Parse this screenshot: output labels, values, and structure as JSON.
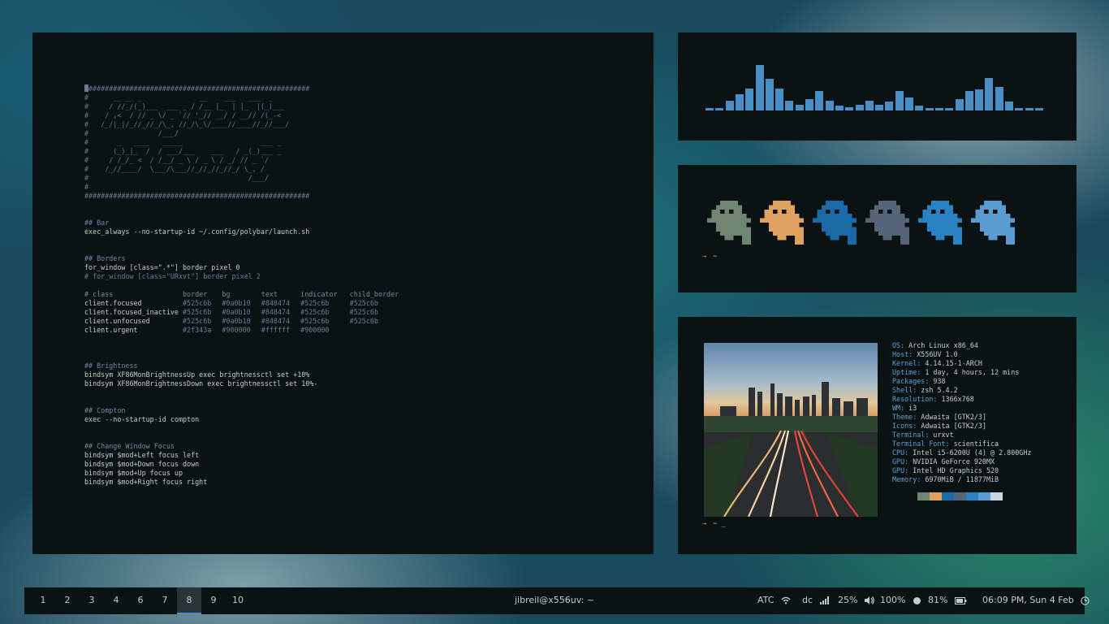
{
  "terminal": {
    "ascii_art": [
      "#######################################################",
      "#      __ __ _              __    ___   ___  _         ",
      "#     / //_/(_)___  ___ _ / /__ |_  | |_  |(_)___     ",
      "#    / ,<  / // _ \\/ _ `// '_// __/ / __// /(_-<     ",
      "#   /_/|_|/_//_//_/\\_, //_/\\_\\/____//____//_//___/     ",
      "#                 /___/                                ",
      "#       _   ____   _____                   ___ _       ",
      "#      (_)_|_  /  / ___/___    ___   / _(_)___ _      ",
      "#     / /_/_ <  / /__/ _ \\ / _ \\ / _/ // _ `/     ",
      "#    /_//____/  \\___/\\___//_//_//_//_/ \\_, /      ",
      "#                                       /___/          ",
      "#",
      "#######################################################"
    ],
    "sections": [
      {
        "header": "## Bar",
        "lines": [
          {
            "t": "exec_always --no-startup-id ~/.config/polybar/launch.sh"
          }
        ]
      },
      {
        "header": "## Borders",
        "lines": [
          {
            "t": "for_window [class=\".*\"] border pixel 0"
          },
          {
            "t": "# for_window [class=\"URxvt\"] border pixel 2",
            "dim": true
          }
        ]
      }
    ],
    "color_table": {
      "header": [
        "# class",
        "border",
        "bg",
        "text",
        "indicator",
        "child_border"
      ],
      "rows": [
        [
          "client.focused",
          "#525c6b",
          "#0a0b10",
          "#848474",
          "#525c6b",
          "#525c6b"
        ],
        [
          "client.focused_inactive",
          "#525c6b",
          "#0a0b10",
          "#848474",
          "#525c6b",
          "#525c6b"
        ],
        [
          "client.unfocused",
          "#525c6b",
          "#0a0b10",
          "#848474",
          "#525c6b",
          "#525c6b"
        ],
        [
          "client.urgent",
          "#2f343a",
          "#900000",
          "#ffffff",
          "#900000",
          ""
        ]
      ]
    },
    "sections2": [
      {
        "header": "## Brightness",
        "lines": [
          "bindsym XF86MonBrightnessUp exec brightnessctl set +10%",
          "bindsym XF86MonBrightnessDown exec brightnessctl set 10%-"
        ]
      },
      {
        "header": "## Compton",
        "lines": [
          "exec --no-startup-id compton"
        ]
      },
      {
        "header": "## Change Window Focus",
        "lines": [
          "bindsym $mod+Left focus left",
          "bindsym $mod+Down focus down",
          "bindsym $mod+Up focus up",
          "bindsym $mod+Right focus right"
        ]
      }
    ]
  },
  "visualizer": {
    "levels": [
      0.05,
      0.05,
      0.22,
      0.35,
      0.48,
      1.0,
      0.7,
      0.48,
      0.22,
      0.12,
      0.25,
      0.42,
      0.22,
      0.1,
      0.08,
      0.12,
      0.22,
      0.12,
      0.2,
      0.42,
      0.28,
      0.1,
      0.05,
      0.05,
      0.05,
      0.25,
      0.42,
      0.47,
      0.72,
      0.52,
      0.2,
      0.05,
      0.05,
      0.05
    ]
  },
  "ghosts": {
    "colors": [
      "#6f8574",
      "#e0a35f",
      "#1b6aa8",
      "#55657a",
      "#2a82c0",
      "#5a9ccf"
    ]
  },
  "prompt1": {
    "symbol": "→",
    "text": "~"
  },
  "prompt2": {
    "symbol": "→",
    "text": "~ _"
  },
  "neofetch": {
    "items": [
      {
        "k": "OS:",
        "v": " Arch Linux x86_64"
      },
      {
        "k": "Host:",
        "v": " X556UV 1.0"
      },
      {
        "k": "Kernel:",
        "v": " 4.14.15-1-ARCH"
      },
      {
        "k": "Uptime:",
        "v": " 1 day, 4 hours, 12 mins"
      },
      {
        "k": "Packages:",
        "v": " 938"
      },
      {
        "k": "Shell:",
        "v": " zsh 5.4.2"
      },
      {
        "k": "Resolution:",
        "v": " 1366x768"
      },
      {
        "k": "WM:",
        "v": " i3"
      },
      {
        "k": "Theme:",
        "v": " Adwaita [GTK2/3]"
      },
      {
        "k": "Icons:",
        "v": " Adwaita [GTK2/3]"
      },
      {
        "k": "Terminal:",
        "v": " urxvt"
      },
      {
        "k": "Terminal Font:",
        "v": " scientifica"
      },
      {
        "k": "CPU:",
        "v": " Intel i5-6200U (4) @ 2.800GHz"
      },
      {
        "k": "GPU:",
        "v": " NVIDIA GeForce 920MX"
      },
      {
        "k": "GPU:",
        "v": " Intel HD Graphics 520"
      },
      {
        "k": "Memory:",
        "v": " 6970MiB / 11877MiB"
      }
    ],
    "swatches": [
      "#0b1214",
      "#6f8574",
      "#e0a35f",
      "#1b6aa8",
      "#55657a",
      "#2a82c0",
      "#5a9ccf",
      "#c5d8e4"
    ]
  },
  "statusbar": {
    "workspaces": [
      "1",
      "2",
      "3",
      "4",
      "6",
      "7",
      "8",
      "9",
      "10"
    ],
    "active": "8",
    "title": "jibreil@x556uv: ~",
    "wifi_name": "ATC",
    "net_name": "dc",
    "volume": "25%",
    "brightness": "100%",
    "battery": "81%",
    "datetime": "06:09 PM, Sun  4 Feb",
    "accent": "#4a8fc6"
  }
}
